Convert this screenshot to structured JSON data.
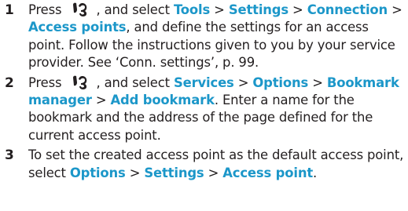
{
  "steps": [
    {
      "number": "1",
      "t0": "Press",
      "t1": ", and select",
      "h1": "Tools",
      "sep1": " > ",
      "h2": "Settings",
      "sep2": " > ",
      "h3": "Connection",
      "sep3": " > ",
      "h4": "Access points",
      "t2": ", and define the settings for an access point. Follow the instructions given to you by your service provider. See ‘Conn. settings’, p. 99."
    },
    {
      "number": "2",
      "t0": "Press",
      "t1": ", and select",
      "h1": "Services",
      "sep1": " > ",
      "h2": "Options",
      "sep2": " > ",
      "h3": "Bookmark manager",
      "sep3": " > ",
      "h4": "Add bookmark",
      "t2": ". Enter a name for the bookmark and the address of the page defined for the current access point."
    },
    {
      "number": "3",
      "t0": "To set the created access point as the default access point, select",
      "h1": "Options",
      "sep1": " > ",
      "h2": "Settings",
      "sep2": " > ",
      "h3": "Access point",
      "t1": "."
    }
  ],
  "icons": {
    "menu_key": "menu-key-icon"
  },
  "colors": {
    "highlight": "#1c97c9",
    "text": "#231f20"
  }
}
